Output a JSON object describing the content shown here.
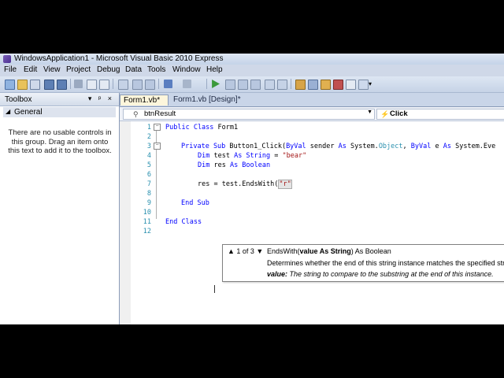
{
  "window": {
    "title": "WindowsApplication1 - Microsoft Visual Basic 2010 Express"
  },
  "menu": [
    "File",
    "Edit",
    "View",
    "Project",
    "Debug",
    "Data",
    "Tools",
    "Window",
    "Help"
  ],
  "toolbox": {
    "title": "Toolbox",
    "controls": "▾ ᵖ ×",
    "group": "General",
    "message": "There are no usable controls in this group. Drag an item onto this text to add it to the toolbox."
  },
  "tabs": [
    {
      "label": "Form1.vb*"
    },
    {
      "label": "Form1.vb [Design]*"
    }
  ],
  "navbar": {
    "object": "btnResult",
    "event": "Click"
  },
  "code": {
    "line_numbers": [
      "1",
      "2",
      "3",
      "4",
      "5",
      "6",
      "7",
      "8",
      "9",
      "10",
      "11",
      "12"
    ],
    "lines": {
      "l1_kw": "Public Class",
      "l1_name": " Form1",
      "l3_kw1": "Private Sub",
      "l3_name": " Button1_Click(",
      "l3_kw2": "ByVal",
      "l3_p1": " sender ",
      "l3_kw3": "As",
      "l3_t1": " System.",
      "l3_t2": "Object",
      "l3_c": ", ",
      "l3_kw4": "ByVal",
      "l3_p2": " e ",
      "l3_kw5": "As",
      "l3_t3": " System.Eve",
      "l4_kw": "Dim",
      "l4_v": " test ",
      "l4_kw2": "As String",
      "l4_eq": " = ",
      "l4_s": "\"bear\"",
      "l5_kw": "Dim",
      "l5_v": " res ",
      "l5_kw2": "As Boolean",
      "l7_code": "res = test.EndsWith(",
      "l7_s": "\"r\"",
      "l9_kw": "End Sub",
      "l11_kw": "End Class"
    }
  },
  "tooltip": {
    "nav": "▲ 1 of 3 ▼",
    "sig_name": "EndsWith(",
    "sig_param": "value As String",
    "sig_rest": ") As Boolean",
    "desc": "Determines whether the end of this string instance matches the specified str",
    "param_name": "value:",
    "param_desc": " The string to compare to the substring at the end of this instance."
  }
}
